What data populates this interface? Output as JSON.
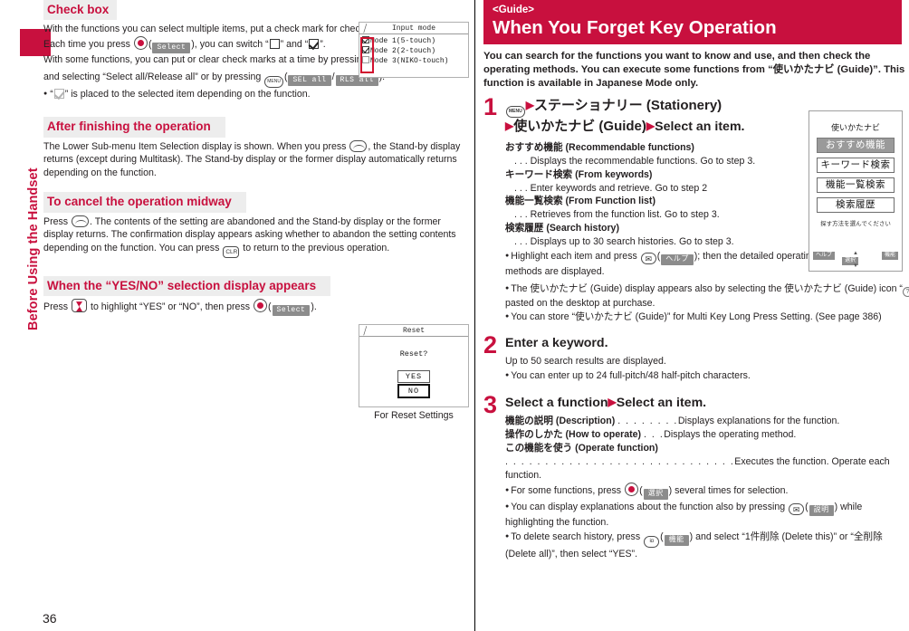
{
  "page": {
    "number": "36",
    "side_tab_label": "Before Using the Handset",
    "accent_color": "#c8103e",
    "header_bg": "#ededed"
  },
  "left_column": {
    "sections": [
      {
        "heading": "Check box",
        "para1": "With the functions you can select multiple items, put a check mark for check boxes to select them.",
        "para2_a": "Each time you press",
        "para2_key_label": "Select",
        "para2_b": "), you can switch “",
        "para2_c": "” and “",
        "para2_d": "”.",
        "para3_a": "With some functions, you can put or clear check marks at a time by pressing",
        "para3_func": "FUNC",
        "para3_b": "and selecting “Select all/Release all” or by pressing",
        "para3_sel": "SEL all",
        "para3_rls": "RLS all",
        "para3_c": ").",
        "bullet": "“       ” is placed to the selected item depending on the function."
      },
      {
        "heading": "After finishing the operation",
        "para_a": "The Lower Sub-menu Item Selection display is shown. When you press",
        "para_b": ", the Stand-by display returns (except during Multitask). The Stand-by display or the former display automatically returns depending on the function."
      },
      {
        "heading": "To cancel the operation midway",
        "para_a": "Press",
        "para_b": ". The contents of the setting are abandoned and the Stand-by display or the former display returns. The confirmation display appears asking whether to abandon the setting contents depending on the function. You can press",
        "clr_key": "CLR",
        "para_c": "to return to the previous operation."
      },
      {
        "heading": "When the “YES/NO” selection display appears",
        "para_a": "Press",
        "para_b": "to highlight “YES” or “NO”, then press",
        "select_label": "Select",
        "para_c": ")."
      }
    ],
    "figure_input_mode": {
      "title": "Input mode",
      "rows": [
        {
          "label": "Mode 1(5-touch)",
          "state": "check-thin"
        },
        {
          "label": "Mode 2(2-touch)",
          "state": "checked"
        },
        {
          "label": "Mode 3(NIKO-touch)",
          "state": "empty"
        }
      ]
    },
    "figure_reset": {
      "title": "Reset",
      "question": "Reset?",
      "yes": "YES",
      "no": "NO",
      "caption": "For Reset Settings"
    }
  },
  "right_column": {
    "banner": {
      "tag": "<Guide>",
      "title": "When You Forget Key Operation"
    },
    "lead": "You can search for the functions you want to know and use, and then check the operating methods. You can execute some functions from “使いかたナビ (Guide)”. This function is available in Japanese Mode only.",
    "steps": [
      {
        "num": "1",
        "menu_key": "MENU",
        "title_line1": "ステーショナリー (Stationery)",
        "title_line2_jp": "使いかたナビ (Guide)",
        "title_line2_en": "Select an item.",
        "options": [
          {
            "jp": "おすすめ機能",
            "en": "(Recommendable functions)",
            "desc": ". . .  Displays the recommendable functions. Go to step 3."
          },
          {
            "jp": "キーワード検索",
            "en": "(From keywords)",
            "desc": ". . .  Enter keywords and retrieve. Go to step 2"
          },
          {
            "jp": "機能一覧検索",
            "en": "(From Function list)",
            "desc": ". . .  Retrieves from the function list. Go to step 3."
          },
          {
            "jp": "検索履歴",
            "en": "(Search history)",
            "desc": ". . .  Displays up to 30 search histories. Go to step 3."
          }
        ],
        "bullets": [
          {
            "a": "Highlight each item and press",
            "softkey": "ヘルプ",
            "b": "); then the detailed operating methods are displayed."
          },
          {
            "a": "The 使いかたナビ (Guide) display appears also by selecting the 使いかたナビ (Guide) icon “",
            "b": "” pasted on the desktop at purchase."
          },
          {
            "a": "You can store “使いかたナビ (Guide)” for Multi Key Long Press Setting. (See page 386)"
          }
        ]
      },
      {
        "num": "2",
        "title": "Enter a keyword.",
        "body": "Up to 50 search results are displayed.",
        "bullets": [
          {
            "a": "You can enter up to 24 full-pitch/48 half-pitch characters."
          }
        ]
      },
      {
        "num": "3",
        "title_a": "Select a function",
        "title_b": "Select an item.",
        "options": [
          {
            "jp": "機能の説明",
            "en": "(Description)",
            "dots": ". . . . . . . .",
            "desc": "Displays explanations for the function."
          },
          {
            "jp": "操作のしかた",
            "en": "(How to operate)",
            "dots": ". . .",
            "desc": "Displays the operating method."
          },
          {
            "jp": "この機能を使う",
            "en": "(Operate function)",
            "dots": "",
            "desc": ""
          }
        ],
        "long_dots": ". . . . . . . . . . . . . . . . . . . . . . . . . . . . .",
        "long_desc": "Executes the function. Operate each function.",
        "bullets": [
          {
            "a": "For some functions, press",
            "softkey": "選択",
            "b": ") several times for selection."
          },
          {
            "a": "You can display explanations about the function also by pressing",
            "softkey": "説明",
            "b": ") while highlighting the function."
          },
          {
            "a": "To delete search history, press",
            "softkey": "機能",
            "b": ") and select “1件削除 (Delete this)” or “全削除 (Delete all)”, then select “YES”."
          }
        ]
      }
    ],
    "figure_guide": {
      "title": "使いかたナビ",
      "buttons": [
        {
          "label": "おすすめ機能",
          "selected": true
        },
        {
          "label": "キーワード検索",
          "selected": false
        },
        {
          "label": "機能一覧検索",
          "selected": false
        },
        {
          "label": "検索履歴",
          "selected": false
        }
      ],
      "note": "探す方法を選んでください",
      "softkey_left": "ヘルプ",
      "softkey_center": "選択",
      "softkey_right": "機能"
    }
  }
}
